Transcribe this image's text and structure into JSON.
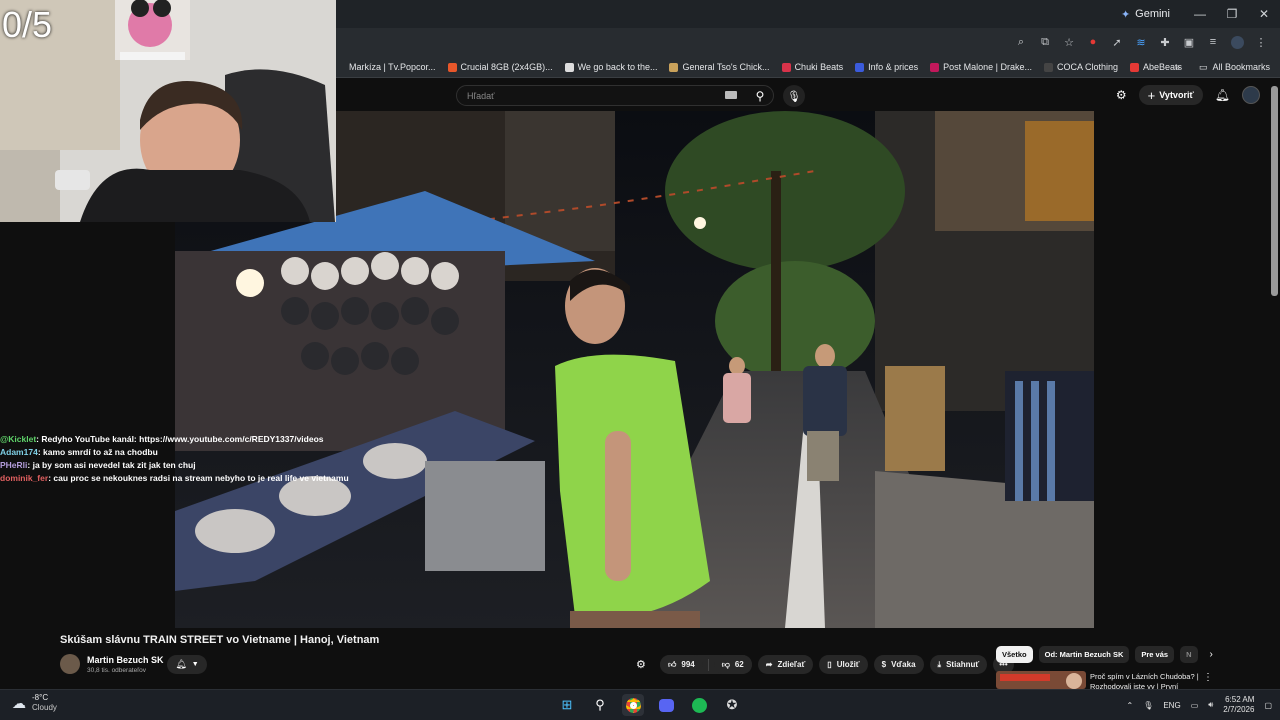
{
  "webcam": {
    "counter": "0/5"
  },
  "browser": {
    "gemini_label": "Gemini",
    "bookmarks": [
      {
        "label": "Markíza | Tv.Popcor...",
        "color": "#00000000"
      },
      {
        "label": "Crucial 8GB (2x4GB)...",
        "color": "#e8572a"
      },
      {
        "label": "We go back to the...",
        "color": "#dddddd"
      },
      {
        "label": "General Tso's Chick...",
        "color": "#c9a25b"
      },
      {
        "label": "Chuki Beats",
        "color": "#d8334a"
      },
      {
        "label": "Info & prices",
        "color": "#3b5bdb"
      },
      {
        "label": "Post Malone | Drake...",
        "color": "#c2185b"
      },
      {
        "label": "COCA Clothing",
        "color": "#444444"
      },
      {
        "label": "AbeBeats",
        "color": "#e53935"
      }
    ],
    "all_bookmarks": "All Bookmarks"
  },
  "youtube": {
    "search_placeholder": "Hľadať",
    "create_label": "Vytvoriť",
    "video_title": "Skúšam slávnu TRAIN STREET vo Vietname | Hanoj, Vietnam",
    "channel_name": "Martin Bezuch SK",
    "channel_subs": "30,8 tis. odberateľov",
    "likes": "994",
    "dislikes": "62",
    "share": "Zdieľať",
    "save": "Uložiť",
    "thanks": "Vďaka",
    "download": "Stiahnuť",
    "filters": [
      "Všetko",
      "Od: Martin Bezuch SK",
      "Pre vás",
      "N"
    ],
    "rec_title": "Proč spím v Lázních Chudoba? | Rozhodovali jste vy | První"
  },
  "chat": [
    {
      "user": "@Kicklet",
      "user_color": "#5fd36a",
      "text": ": Redyho YouTube kanál: https://www.youtube.com/c/REDY1337/videos"
    },
    {
      "user": "Adam174",
      "user_color": "#7fd0e6",
      "text": ": kamo smrdí to až na chodbu"
    },
    {
      "user": "PHeRli",
      "user_color": "#b39ddb",
      "text": ": ja by som asi nevedel tak zit jak ten chuj"
    },
    {
      "user": "dominik_fer",
      "user_color": "#e06060",
      "text": ": cau proc se nekouknes radsi na stream nebyho to je real life ve vietnamu"
    }
  ],
  "taskbar": {
    "temp": "-8°C",
    "weather": "Cloudy",
    "lang": "ENG",
    "time": "6:52 AM",
    "date": "2/7/2026"
  }
}
